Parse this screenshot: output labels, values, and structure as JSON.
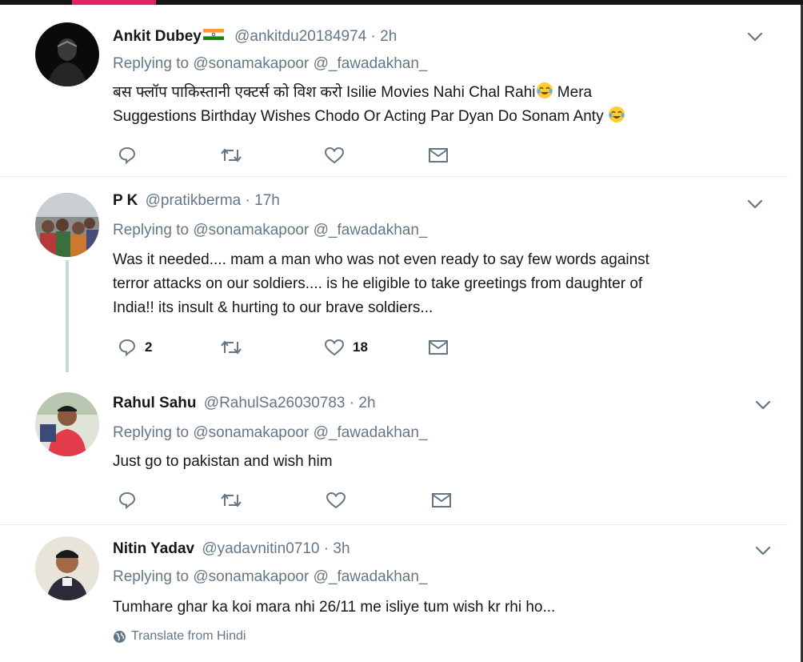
{
  "replying_label": "Replying to",
  "tweets": [
    {
      "name": "Ankit Dubey",
      "handle": "@ankitdu20184974",
      "time": "2h",
      "mentions": [
        "@sonamakapoor",
        "@_fawadakhan_"
      ],
      "text_line1": "बस फ्लॉप पाकिस्तानी एक्टर्स को विश करो Isilie Movies Nahi Chal Rahi",
      "text_line1_tail": " Mera",
      "text_line2": "Suggestions Birthday Wishes Chodo Or Acting Par Dyan Do Sonam Anty ",
      "reply_count": "",
      "like_count": ""
    },
    {
      "name": "P K",
      "handle": "@pratikberma",
      "time": "17h",
      "mentions": [
        "@sonamakapoor",
        "@_fawadakhan_"
      ],
      "text_line1": "Was it needed.... mam a man who was not even ready to say few words against",
      "text_line2": "terror attacks on our soldiers.... is he eligible to take greetings from daughter of",
      "text_line3": "India!! its insult & hurting to our brave soldiers...",
      "reply_count": "2",
      "like_count": "18"
    },
    {
      "name": "Rahul Sahu",
      "handle": "@RahulSa26030783",
      "time": "2h",
      "mentions": [
        "@sonamakapoor",
        "@_fawadakhan_"
      ],
      "text_line1": "Just go to pakistan and wish him",
      "reply_count": "",
      "like_count": ""
    },
    {
      "name": "Nitin Yadav",
      "handle": "@yadavnitin0710",
      "time": "3h",
      "mentions": [
        "@sonamakapoor",
        "@_fawadakhan_"
      ],
      "text_line1": "Tumhare ghar ka koi mara nhi 26/11 me isliye tum wish kr rhi ho...",
      "translate": "Translate from Hindi"
    }
  ],
  "icons": {
    "reply": "reply-icon",
    "retweet": "retweet-icon",
    "like": "like-icon",
    "message": "direct-message-icon",
    "caret": "chevron-down-icon",
    "globe": "globe-icon",
    "flag": "india-flag-icon",
    "emoji": "face-with-tears-of-joy-icon"
  },
  "colors": {
    "text": "#14171a",
    "secondary": "#657786",
    "divider": "#e6ecf0",
    "top_accent": "#e0245e"
  }
}
